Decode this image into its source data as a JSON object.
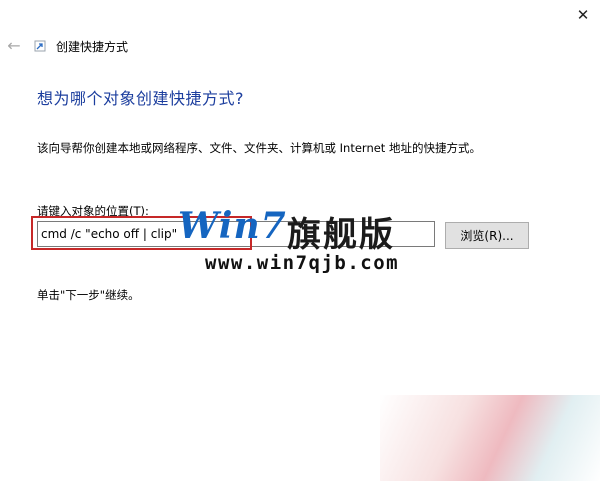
{
  "window": {
    "title": "创建快捷方式",
    "close_glyph": "✕",
    "back_glyph": "←"
  },
  "wizard": {
    "heading": "想为哪个对象创建快捷方式?",
    "description": "该向导帮你创建本地或网络程序、文件、文件夹、计算机或 Internet 地址的快捷方式。",
    "location_label": "请键入对象的位置(T):",
    "location_value": "cmd /c \"echo off | clip\"",
    "browse_label": "浏览(R)...",
    "hint": "单击\"下一步\"继续。"
  },
  "watermark": {
    "logo": "Win7",
    "cn_text": "旗舰版",
    "url": "www.win7qjb.com"
  },
  "colors": {
    "heading": "#1c3e9e",
    "highlight": "#c62828",
    "logo_blue": "#1565c0"
  }
}
